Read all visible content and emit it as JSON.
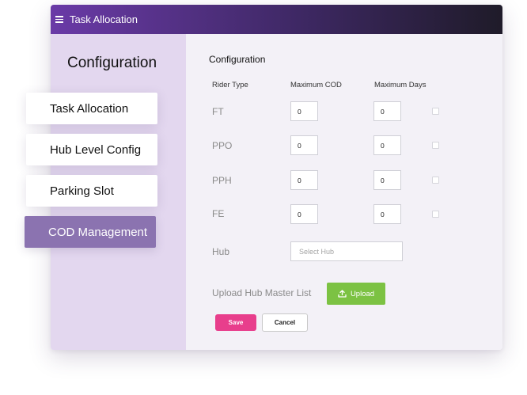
{
  "header": {
    "title": "Task Allocation",
    "menu_icon": "hamburger-menu-icon"
  },
  "sidebar": {
    "heading": "Configuration",
    "items": [
      {
        "label": "Task Allocation",
        "active": false
      },
      {
        "label": "Hub Level Config",
        "active": false
      },
      {
        "label": "Parking Slot",
        "active": false
      },
      {
        "label": "COD Management",
        "active": true
      }
    ]
  },
  "form": {
    "title": "Configuration",
    "columns": [
      "Rider Type",
      "Maximum COD",
      "Maximum Days"
    ],
    "rows": [
      {
        "rider_type": "FT",
        "max_cod": "0",
        "max_days": "0",
        "checked": false
      },
      {
        "rider_type": "PPO",
        "max_cod": "0",
        "max_days": "0",
        "checked": false
      },
      {
        "rider_type": "PPH",
        "max_cod": "0",
        "max_days": "0",
        "checked": false
      },
      {
        "rider_type": "FE",
        "max_cod": "0",
        "max_days": "0",
        "checked": false
      }
    ],
    "hub_label": "Hub",
    "hub_placeholder": "Select Hub",
    "upload_label": "Upload Hub Master List",
    "upload_button": "Upload",
    "upload_icon": "upload-icon",
    "save_button": "Save",
    "cancel_button": "Cancel"
  },
  "colors": {
    "header_start": "#6a3aa7",
    "header_end": "#1f1b29",
    "sidebar_bg": "#e3d7ef",
    "active_nav": "#8b73b0",
    "upload": "#7cc243",
    "save": "#e83e8c"
  }
}
